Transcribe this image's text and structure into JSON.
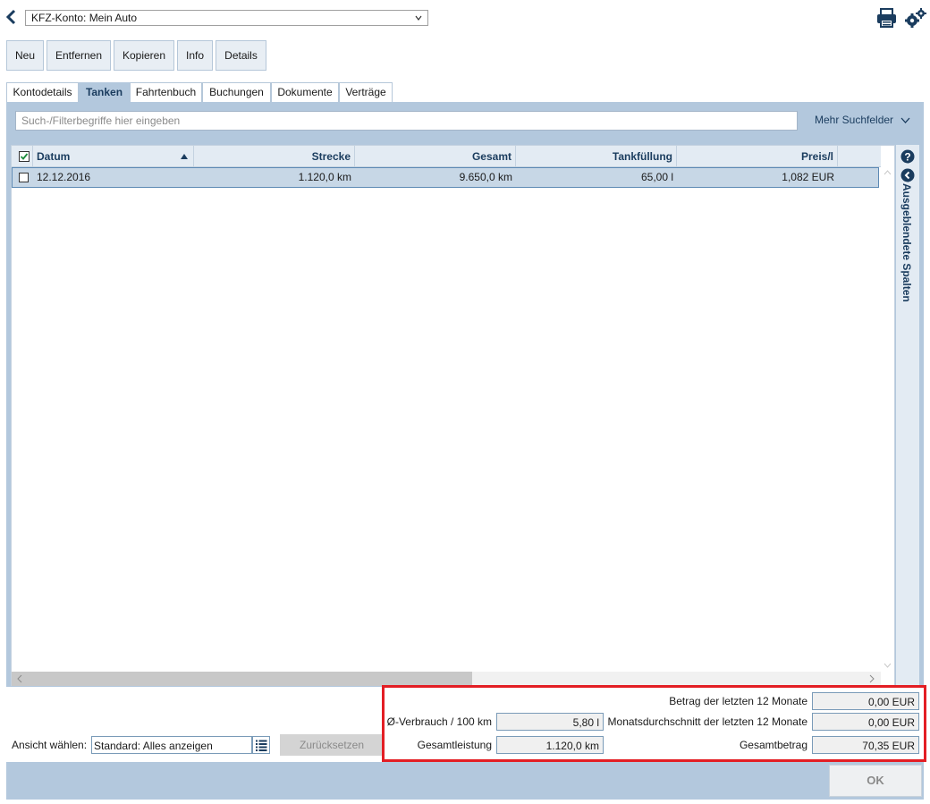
{
  "header": {
    "account_select": "KFZ-Konto: Mein Auto"
  },
  "toolbar": {
    "new": "Neu",
    "remove": "Entfernen",
    "copy": "Kopieren",
    "info": "Info",
    "details": "Details"
  },
  "tabs": [
    "Kontodetails",
    "Tanken",
    "Fahrtenbuch",
    "Buchungen",
    "Dokumente",
    "Verträge"
  ],
  "search": {
    "placeholder": "Such-/Filterbegriffe hier eingeben",
    "more_fields": "Mehr Suchfelder"
  },
  "table": {
    "columns": [
      "Datum",
      "Strecke",
      "Gesamt",
      "Tankfüllung",
      "Preis/l"
    ],
    "rows": [
      {
        "datum": "12.12.2016",
        "strecke": "1.120,0 km",
        "gesamt": "9.650,0 km",
        "tankfuellung": "65,00 l",
        "preis": "1,082 EUR"
      }
    ],
    "hidden_columns_label": "Ausgeblendete Spalten"
  },
  "summary": {
    "betrag_12_label": "Betrag der letzten 12 Monate",
    "betrag_12_value": "0,00 EUR",
    "verbrauch_label": "Ø-Verbrauch / 100 km",
    "verbrauch_value": "5,80 l",
    "monatsdurchschnitt_label": "Monatsdurchschnitt der letzten 12 Monate",
    "monatsdurchschnitt_value": "0,00 EUR",
    "gesamtleistung_label": "Gesamtleistung",
    "gesamtleistung_value": "1.120,0 km",
    "gesamtbetrag_label": "Gesamtbetrag",
    "gesamtbetrag_value": "70,35 EUR"
  },
  "view": {
    "label": "Ansicht wählen:",
    "value": "Standard: Alles anzeigen",
    "reset": "Zurücksetzen"
  },
  "footer": {
    "ok": "OK"
  },
  "colors": {
    "accent": "#1a3c5e",
    "panel": "#b3c8dd",
    "highlight": "#e31e24"
  }
}
